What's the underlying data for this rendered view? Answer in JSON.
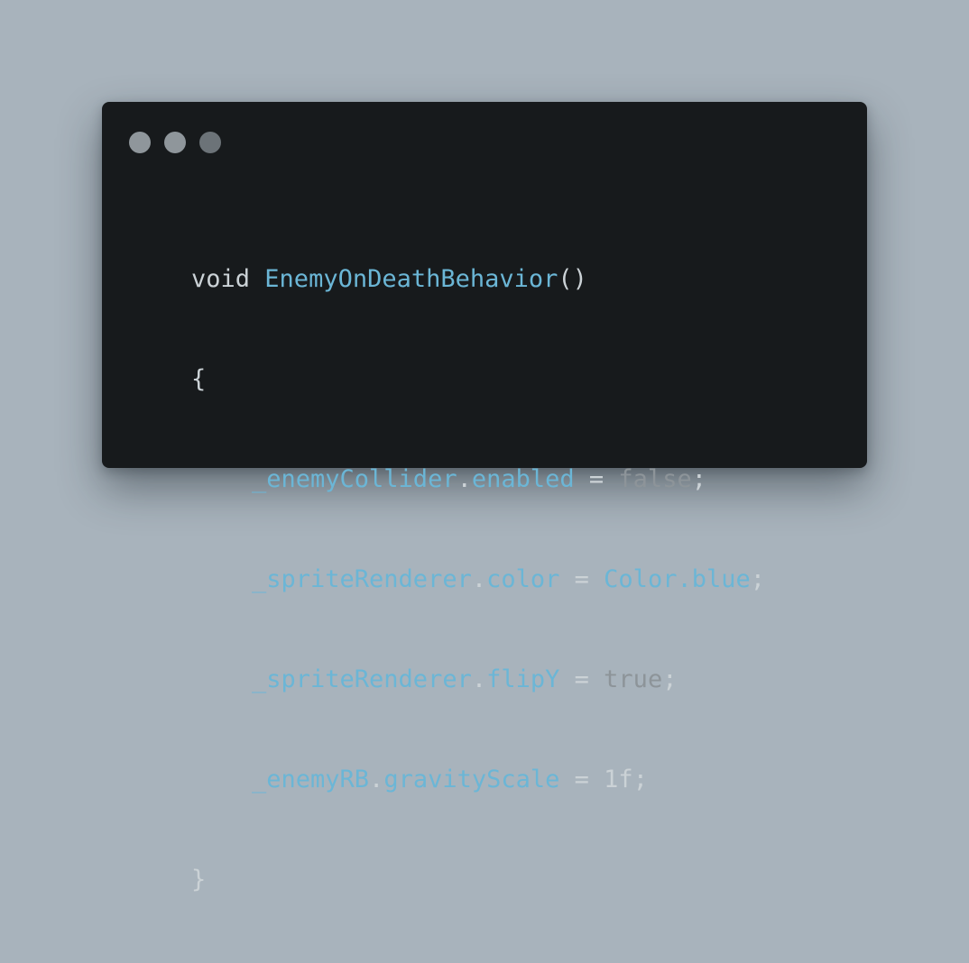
{
  "window": {
    "background": "#171a1c",
    "page_background": "#a8b3bc",
    "dots": [
      "dot-1",
      "dot-2",
      "dot-3"
    ]
  },
  "colors": {
    "identifier": "#6bb6d6",
    "plain": "#cbd2d6",
    "literal": "#8d9499",
    "dot": "#8f969b"
  },
  "code": {
    "line1": {
      "keyword": "void",
      "function": "EnemyOnDeathBehavior",
      "parens": "()"
    },
    "line2": {
      "brace": "{"
    },
    "line3": {
      "object": "_enemyCollider",
      "dot": ".",
      "property": "enabled",
      "op": " = ",
      "value": "false",
      "end": ";"
    },
    "line4": {
      "object": "_spriteRenderer",
      "dot": ".",
      "property": "color",
      "op": " = ",
      "value": "Color.blue",
      "end": ";"
    },
    "line5": {
      "object": "_spriteRenderer",
      "dot": ".",
      "property": "flipY",
      "op": " = ",
      "value": "true",
      "end": ";"
    },
    "line6": {
      "object": "_enemyRB",
      "dot": ".",
      "property": "gravityScale",
      "op": " = ",
      "value": "1f",
      "end": ";"
    },
    "line7": {
      "brace": "}"
    }
  }
}
